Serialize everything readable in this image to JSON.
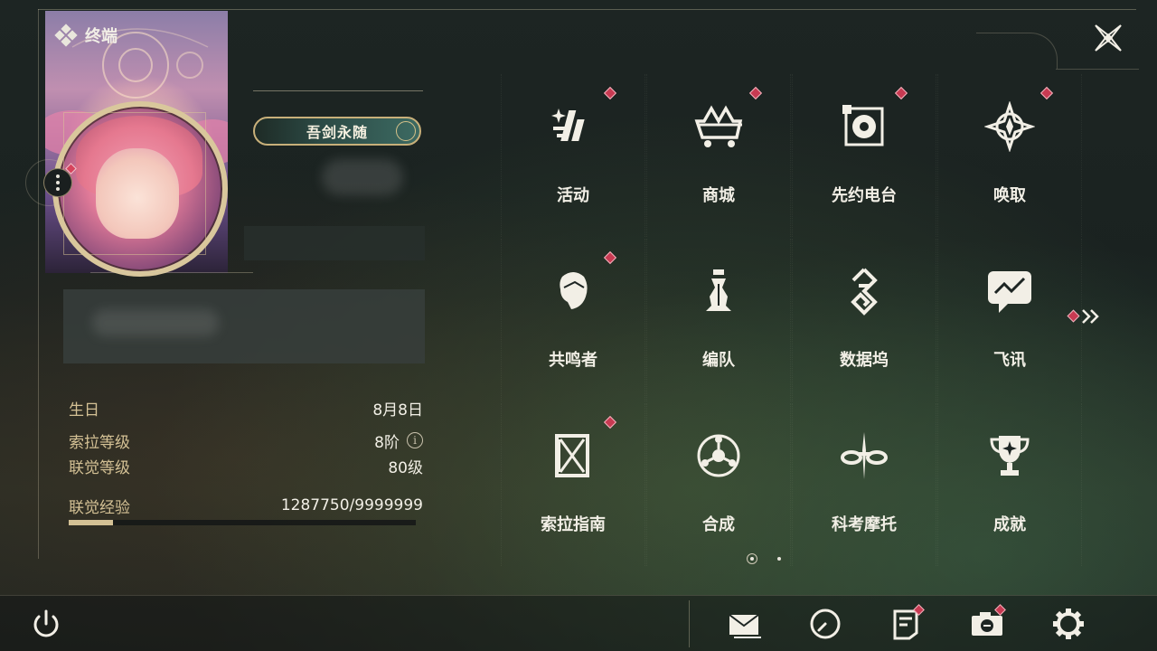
{
  "header": {
    "title": "终端",
    "title_icon": "diamond-cluster-icon",
    "close_icon": "close-icon"
  },
  "profile": {
    "name": "吾剑永随",
    "avatar_badge_color": "#c83a52"
  },
  "stats": {
    "birthday_label": "生日",
    "birthday_value": "8月8日",
    "sola_level_label": "索拉等级",
    "sola_level_value": "8阶",
    "union_level_label": "联觉等级",
    "union_level_value": "80级",
    "union_exp_label": "联觉经验",
    "union_exp_value": "1287750/9999999",
    "union_exp_fraction": 0.1288
  },
  "menu": {
    "tiles": [
      {
        "label": "活动",
        "icon": "sparkle-activity-icon",
        "notify": true
      },
      {
        "label": "商城",
        "icon": "shop-cart-icon",
        "notify": true
      },
      {
        "label": "先约电台",
        "icon": "radio-icon",
        "notify": true
      },
      {
        "label": "唤取",
        "icon": "compass-star-icon",
        "notify": true
      },
      {
        "label": "共鸣者",
        "icon": "resonator-head-icon",
        "notify": true
      },
      {
        "label": "编队",
        "icon": "chess-team-icon",
        "notify": false
      },
      {
        "label": "数据坞",
        "icon": "data-bank-icon",
        "notify": false
      },
      {
        "label": "飞讯",
        "icon": "chat-bubble-icon",
        "notify": false
      },
      {
        "label": "索拉指南",
        "icon": "guide-book-icon",
        "notify": true
      },
      {
        "label": "合成",
        "icon": "synthesis-icon",
        "notify": false
      },
      {
        "label": "科考摩托",
        "icon": "motorcycle-icon",
        "notify": false
      },
      {
        "label": "成就",
        "icon": "trophy-icon",
        "notify": false
      }
    ]
  },
  "bottom_bar": {
    "icons": [
      "power-icon",
      "mail-icon",
      "clock-icon",
      "notice-icon",
      "camera-icon",
      "settings-icon"
    ]
  },
  "colors": {
    "accent_gold": "#d4c195",
    "notify_red": "#c83a52",
    "text": "#f2efe6"
  }
}
